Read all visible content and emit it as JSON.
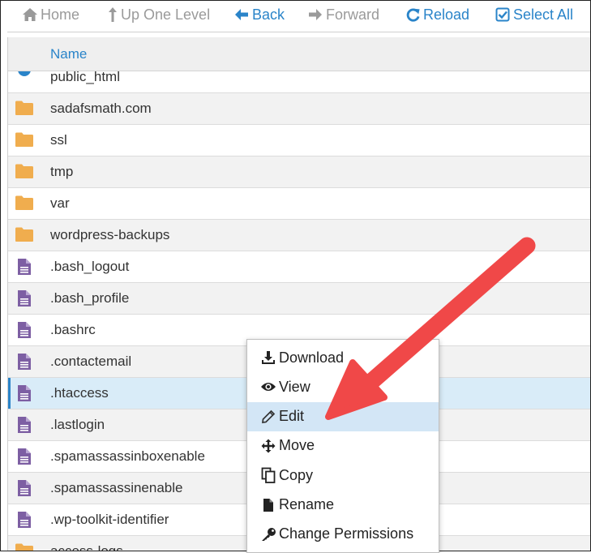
{
  "toolbar": {
    "home": "Home",
    "up_one_level": "Up One Level",
    "back": "Back",
    "forward": "Forward",
    "reload": "Reload",
    "select_all": "Select All"
  },
  "table": {
    "column_name": "Name",
    "rows": [
      {
        "name": "public_html",
        "type": "web-folder"
      },
      {
        "name": "sadafsmath.com",
        "type": "folder"
      },
      {
        "name": "ssl",
        "type": "folder"
      },
      {
        "name": "tmp",
        "type": "folder"
      },
      {
        "name": "var",
        "type": "folder"
      },
      {
        "name": "wordpress-backups",
        "type": "folder"
      },
      {
        "name": ".bash_logout",
        "type": "file"
      },
      {
        "name": ".bash_profile",
        "type": "file"
      },
      {
        "name": ".bashrc",
        "type": "file"
      },
      {
        "name": ".contactemail",
        "type": "file"
      },
      {
        "name": ".htaccess",
        "type": "file",
        "selected": true
      },
      {
        "name": ".lastlogin",
        "type": "file"
      },
      {
        "name": ".spamassassinboxenable",
        "type": "file"
      },
      {
        "name": ".spamassassinenable",
        "type": "file"
      },
      {
        "name": ".wp-toolkit-identifier",
        "type": "file"
      },
      {
        "name": "access-logs",
        "type": "link-folder"
      }
    ]
  },
  "context_menu": {
    "items": [
      {
        "label": "Download",
        "icon": "download-icon"
      },
      {
        "label": "View",
        "icon": "eye-icon"
      },
      {
        "label": "Edit",
        "icon": "pencil-icon",
        "highlighted": true
      },
      {
        "label": "Move",
        "icon": "move-icon"
      },
      {
        "label": "Copy",
        "icon": "copy-icon"
      },
      {
        "label": "Rename",
        "icon": "file-icon"
      },
      {
        "label": "Change Permissions",
        "icon": "key-icon"
      }
    ]
  },
  "colors": {
    "accent": "#2a84c9",
    "folder": "#f0ad4e",
    "file": "#7d5fa3",
    "selected_row": "#d9ecf8",
    "highlight_item": "#d3e6f6",
    "annotation_arrow": "#f04848"
  }
}
